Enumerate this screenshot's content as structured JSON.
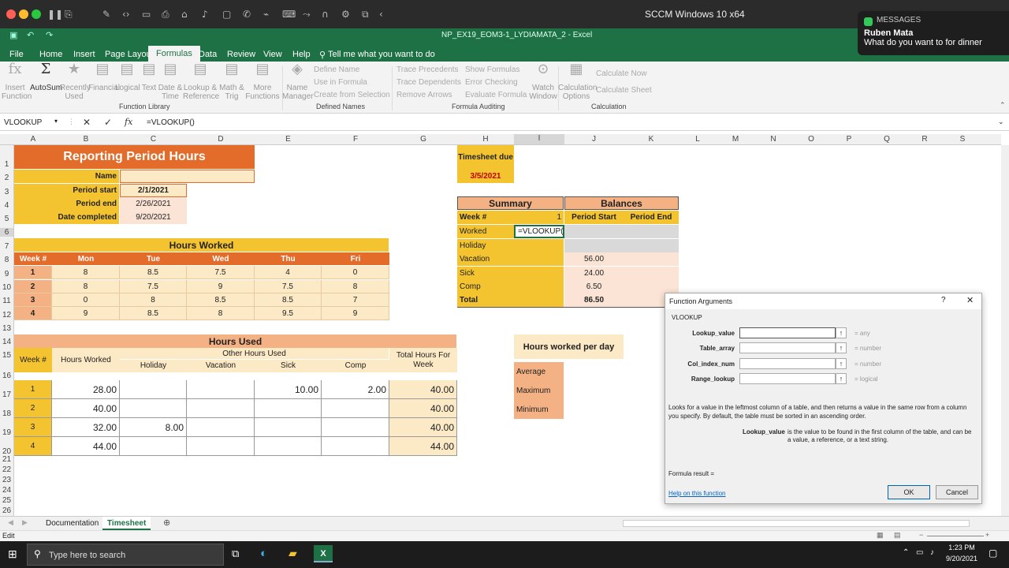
{
  "mac": {
    "title": "SCCM Windows 10 x64"
  },
  "notification": {
    "app": "MESSAGES",
    "sender": "Ruben Mata",
    "message": "What do you want to for dinner"
  },
  "excel": {
    "filename": "NP_EX19_EOM3-1_LYDIAMATA_2  -  Excel",
    "tabs": [
      "File",
      "Home",
      "Insert",
      "Page Layout",
      "Formulas",
      "Data",
      "Review",
      "View",
      "Help"
    ],
    "tell_me": "Tell me what you want to do",
    "ribbon": {
      "insert_function": "Insert\nFunction",
      "autosum": "AutoSum",
      "recently_used": "Recently\nUsed",
      "financial": "Financial",
      "logical": "Logical",
      "text": "Text",
      "date_time": "Date &\nTime",
      "lookup": "Lookup &\nReference",
      "math": "Math &\nTrig",
      "more": "More\nFunctions",
      "name_manager": "Name\nManager",
      "define_name": "Define Name",
      "use_in_formula": "Use in Formula",
      "create_from_selection": "Create from Selection",
      "trace_precedents": "Trace Precedents",
      "trace_dependents": "Trace Dependents",
      "remove_arrows": "Remove Arrows",
      "show_formulas": "Show Formulas",
      "error_checking": "Error Checking",
      "evaluate_formula": "Evaluate Formula",
      "watch_window": "Watch\nWindow",
      "calc_options": "Calculation\nOptions",
      "calc_now": "Calculate Now",
      "calc_sheet": "Calculate Sheet",
      "groups": {
        "function_library": "Function Library",
        "defined_names": "Defined Names",
        "formula_auditing": "Formula Auditing",
        "calculation": "Calculation"
      }
    },
    "namebox": "VLOOKUP",
    "formula": "=VLOOKUP()",
    "columns": [
      "A",
      "B",
      "C",
      "D",
      "E",
      "F",
      "G",
      "H",
      "I",
      "J",
      "K",
      "L",
      "M",
      "N",
      "O",
      "P",
      "Q",
      "R",
      "S"
    ],
    "rows": [
      "1",
      "2",
      "3",
      "4",
      "5",
      "6",
      "7",
      "8",
      "9",
      "10",
      "11",
      "12",
      "13",
      "14",
      "15",
      "16",
      "17",
      "18",
      "19",
      "20",
      "21",
      "22",
      "23",
      "24",
      "25",
      "26"
    ],
    "report": {
      "title": "Reporting Period Hours",
      "name_label": "Name",
      "period_start_label": "Period start",
      "period_start": "2/1/2021",
      "period_end_label": "Period end",
      "period_end": "2/26/2021",
      "date_completed_label": "Date completed",
      "date_completed": "9/20/2021",
      "timesheet_due_label": "Timesheet due",
      "timesheet_due": "3/5/2021"
    },
    "hours_worked": {
      "title": "Hours Worked",
      "headers": [
        "Week #",
        "Mon",
        "Tue",
        "Wed",
        "Thu",
        "Fri"
      ],
      "rows": [
        [
          "1",
          "8",
          "8.5",
          "7.5",
          "4",
          "0"
        ],
        [
          "2",
          "8",
          "7.5",
          "9",
          "7.5",
          "8"
        ],
        [
          "3",
          "0",
          "8",
          "8.5",
          "8.5",
          "7"
        ],
        [
          "4",
          "9",
          "8.5",
          "8",
          "9.5",
          "9"
        ]
      ]
    },
    "summary": {
      "title": "Summary",
      "balances_title": "Balances",
      "week_label": "Week #",
      "week_value": "1",
      "period_start": "Period Start",
      "period_end": "Period End",
      "labels": [
        "Worked",
        "Holiday",
        "Vacation",
        "Sick",
        "Comp",
        "Total"
      ],
      "active_cell": "=VLOOKUP()",
      "balances": [
        "",
        "",
        "56.00",
        "24.00",
        "6.50",
        "86.50"
      ]
    },
    "hours_used": {
      "title": "Hours Used",
      "other_hours": "Other Hours Used",
      "headers": [
        "Week #",
        "Hours Worked",
        "Holiday",
        "Vacation",
        "Sick",
        "Comp",
        "Total Hours For Week"
      ],
      "rows": [
        [
          "1",
          "28.00",
          "",
          "",
          "10.00",
          "2.00",
          "40.00"
        ],
        [
          "2",
          "40.00",
          "",
          "",
          "",
          "",
          "40.00"
        ],
        [
          "3",
          "32.00",
          "8.00",
          "",
          "",
          "",
          "40.00"
        ],
        [
          "4",
          "44.00",
          "",
          "",
          "",
          "",
          "44.00"
        ]
      ]
    },
    "per_day": {
      "title": "Hours worked per day",
      "labels": [
        "Average",
        "Maximum",
        "Minimum"
      ]
    },
    "sheets": [
      "Documentation",
      "Timesheet"
    ],
    "status": "Edit"
  },
  "dialog": {
    "title": "Function Arguments",
    "function_name": "VLOOKUP",
    "args": [
      {
        "name": "Lookup_value",
        "hint": "any"
      },
      {
        "name": "Table_array",
        "hint": "number"
      },
      {
        "name": "Col_index_num",
        "hint": "number"
      },
      {
        "name": "Range_lookup",
        "hint": "logical"
      }
    ],
    "description": "Looks for a value in the leftmost column of a table, and then returns a value in the same row from a column you specify. By default, the table must be sorted in an ascending order.",
    "arg_detail_name": "Lookup_value",
    "arg_detail": "is the value to be found in the first column of the table, and can be a value, a reference, or a text string.",
    "formula_result": "Formula result =",
    "help": "Help on this function",
    "ok": "OK",
    "cancel": "Cancel"
  },
  "taskbar": {
    "search_placeholder": "Type here to search",
    "time": "1:23 PM",
    "date": "9/20/2021"
  }
}
